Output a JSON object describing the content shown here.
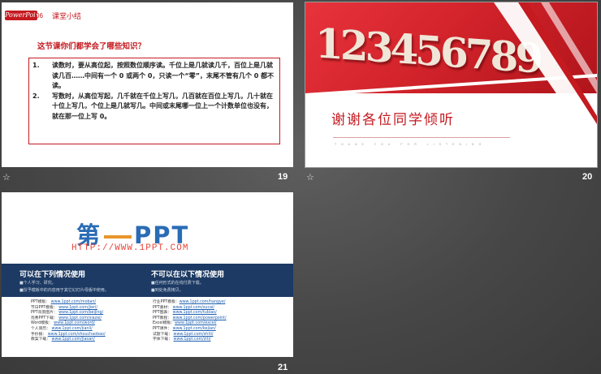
{
  "slides": [
    {
      "number": "19",
      "star": "☆",
      "tag": "PowerPoint",
      "section_no": "06",
      "section_title": "课堂小结",
      "question": "这节课你们都学会了哪些知识？",
      "items": [
        {
          "n": "1.",
          "text": "读数时，要从高位起，按照数位顺序读。千位上是几就读几千，百位上是几就读几百……中间有一个 0 或两个 0，只读一个“零”，末尾不管有几个 0 都不读。"
        },
        {
          "n": "2.",
          "text": "写数时，从高位写起，几千就在千位上写几，几百就在百位上写几，几十就在十位上写几，个位上是几就写几。中间或末尾哪一位上一个计数单位也没有，就在那一位上写 0。"
        }
      ]
    },
    {
      "number": "20",
      "star": "☆",
      "digits": "123456789",
      "title": "谢谢各位同学倾听",
      "subtitle": "THANK YOU FOR LISTENING"
    },
    {
      "number": "21",
      "logo_a": "第",
      "logo_b": "PPT",
      "url": "HTTP://WWW.1PPT.COM",
      "left_head": "可以在下列情况使用",
      "left_b1": "■个人学习、研究。",
      "left_b2": "■授予模板中的内容用于其它幻灯片母版中使用。",
      "right_head": "不可以在以下情况使用",
      "right_b1": "■任何形式的在线付费下载。",
      "right_b2": "■到处免费拷贝。",
      "left_links": [
        {
          "label": "PPT模板：",
          "url": "www.1ppt.com/moban/"
        },
        {
          "label": "节日PPT模板：",
          "url": "www.1ppt.com/jieri/"
        },
        {
          "label": "PPT背景图片：",
          "url": "www.1ppt.com/beijing/"
        },
        {
          "label": "优秀PPT下载：",
          "url": "www.1ppt.com/xiazai/"
        },
        {
          "label": "Word模板：",
          "url": "www.1ppt.com/word/"
        },
        {
          "label": "个人简历：",
          "url": "www.1ppt.com/jianli/"
        },
        {
          "label": "手抄报：",
          "url": "www.1ppt.com/shouchaobao/"
        },
        {
          "label": "教案下载：",
          "url": "www.1ppt.com/jiaoan/"
        }
      ],
      "right_links": [
        {
          "label": "行业PPT模板：",
          "url": "www.1ppt.com/hangye/"
        },
        {
          "label": "PPT素材：",
          "url": "www.1ppt.com/sucai/"
        },
        {
          "label": "PPT图表：",
          "url": "www.1ppt.com/tubiao/"
        },
        {
          "label": "PPT教程：",
          "url": "www.1ppt.com/powerpoint/"
        },
        {
          "label": "Excel模板：",
          "url": "www.1ppt.com/excel/"
        },
        {
          "label": "PPT课件：",
          "url": "www.1ppt.com/kejian/"
        },
        {
          "label": "试题下载：",
          "url": "www.1ppt.com/shiti/"
        },
        {
          "label": "字体下载：",
          "url": "www.1ppt.com/ziti/"
        }
      ]
    }
  ]
}
